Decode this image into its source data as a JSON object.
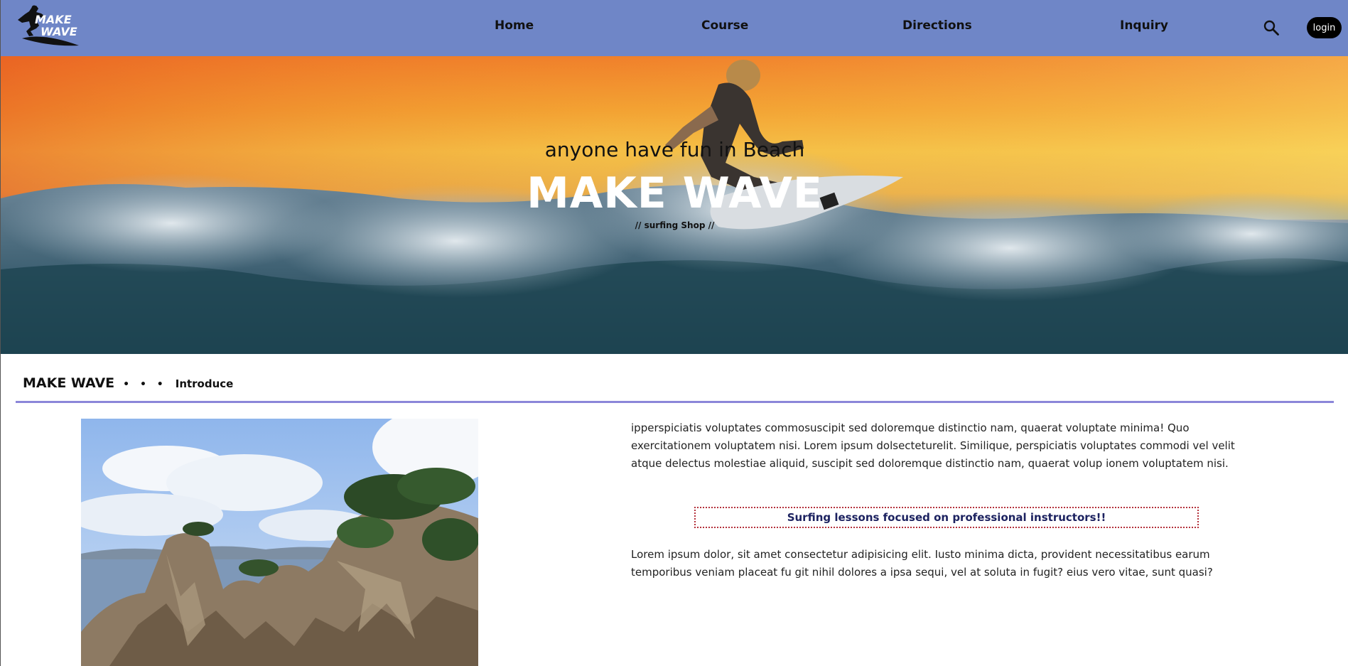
{
  "header": {
    "logo_text_line1": "MAKE",
    "logo_text_line2": "WAVE",
    "nav": [
      {
        "label": "Home"
      },
      {
        "label": "Course"
      },
      {
        "label": "Directions"
      },
      {
        "label": "Inquiry"
      }
    ],
    "search_icon": "search-icon",
    "login_label": "login",
    "background_color": "#6f86c7"
  },
  "hero": {
    "tagline": "anyone have fun in Beach",
    "title": "MAKE WAVE",
    "subtitle": "// surfing Shop //"
  },
  "intro": {
    "brand": "MAKE WAVE",
    "dots": "• • •",
    "label": "Introduce",
    "rule_color": "#8b86d9",
    "paragraph_1": "ipperspiciatis voluptates commosuscipit sed doloremque distinctio nam, quaerat voluptate minima! Quo exercitationem voluptatem nisi. Lorem ipsum dolsecteturelit. Similique, perspiciatis voluptates commodi vel velit atque delectus molestiae aliquid, suscipit sed doloremque distinctio nam, quaerat volup ionem voluptatem nisi.",
    "highlight": "Surfing lessons focused on professional instructors!!",
    "paragraph_2": "Lorem ipsum dolor, sit amet consectetur adipisicing elit. Iusto minima dicta, provident necessitatibus earum temporibus veniam placeat fu git nihil dolores a ipsa sequi, vel at soluta in fugit? eius vero vitae, sunt quasi?"
  }
}
